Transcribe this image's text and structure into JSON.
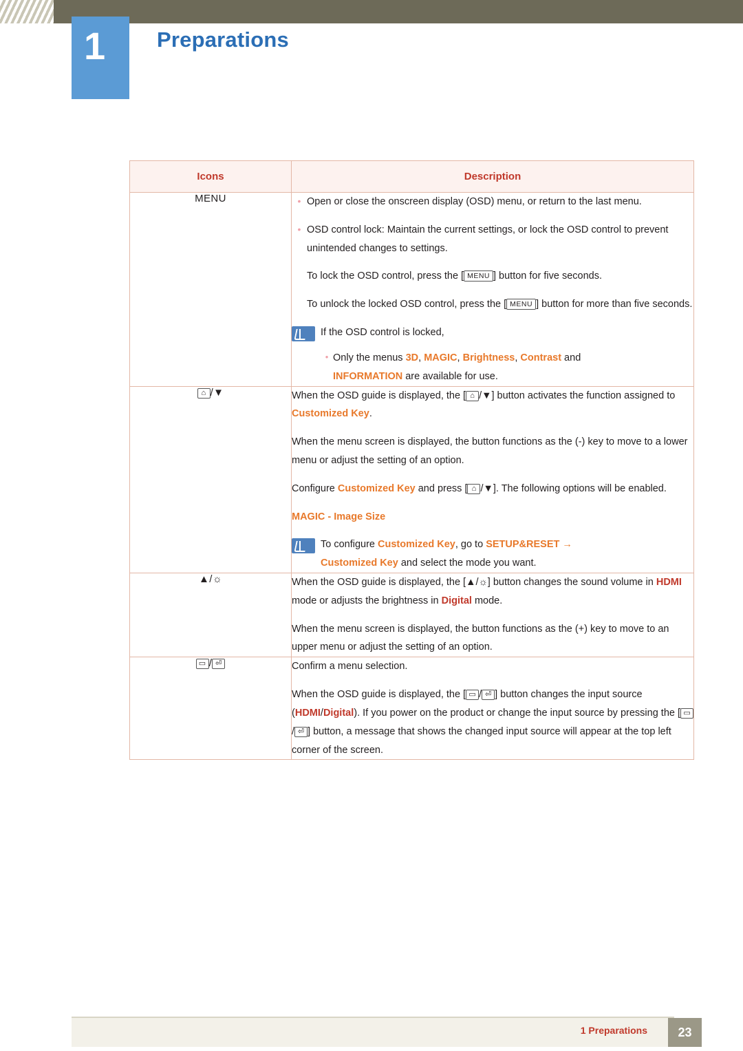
{
  "header": {
    "chapter_number": "1",
    "chapter_title": "Preparations"
  },
  "table": {
    "columns": [
      "Icons",
      "Description"
    ],
    "rows": [
      {
        "icon_label": "MENU",
        "icon_name": "menu-button-label"
      },
      {
        "icon_label": "/",
        "icon_name": "down-arrow-key-label"
      },
      {
        "icon_label": "/",
        "icon_name": "up-arrow-brightness-key-label"
      },
      {
        "icon_label": "/",
        "icon_name": "enter-source-key-label"
      }
    ],
    "row1": {
      "b1": "Open or close the onscreen display (OSD) menu, or return to the last menu.",
      "b2": "OSD control lock: Maintain the current settings, or lock the OSD control to prevent unintended changes to settings.",
      "p_lock_a": "To lock the OSD control, press the [",
      "key_menu": "MENU",
      "p_lock_b": "] button for five seconds.",
      "p_unlock_a": "To unlock the locked OSD control, press the [",
      "p_unlock_b": "] button for more than five seconds.",
      "note_head": "If the OSD control is locked,",
      "note_line_a": "Only the menus ",
      "note_3d": "3D",
      "note_sep1": ", ",
      "note_magic": "MAGIC",
      "note_sep2": ", ",
      "note_brightness": "Brightness",
      "note_sep3": ", ",
      "note_contrast": "Contrast",
      "note_and": " and",
      "note_information": "INFORMATION",
      "note_tail": " are available for use."
    },
    "row2": {
      "p1_a": "When the OSD guide is displayed, the [",
      "p1_b": "] button activates the function assigned to ",
      "p1_key": "Customized Key",
      "p1_c": ".",
      "p2": "When the menu screen is displayed, the button functions as the (-) key to move to a lower menu or adjust the setting of an option.",
      "p3_a": "Configure ",
      "p3_key": "Customized Key",
      "p3_b": " and press [",
      "p3_c": "]. The following options will be enabled.",
      "p4_magic": "MAGIC",
      "p4_rest": " - Image Size",
      "note_a": "To configure ",
      "note_key": "Customized Key",
      "note_b": ", go to ",
      "note_setup": "SETUP&RESET",
      "note_arrow": "→",
      "note_key2": "Customized Key",
      "note_c": " and select the mode you want."
    },
    "row3": {
      "p1_a": "When the OSD guide is displayed, the [",
      "p1_b": "] button changes the sound volume in ",
      "p1_hdmi": "HDMI",
      "p1_c": " mode or adjusts the brightness in ",
      "p1_digital": "Digital",
      "p1_d": " mode.",
      "p2": "When the menu screen is displayed, the button functions as the (+) key to move to an upper menu or adjust the setting of an option."
    },
    "row4": {
      "p1": "Confirm a menu selection.",
      "p2_a": "When the OSD guide is displayed, the [",
      "p2_b": "] button changes the input source (",
      "p2_hdmi": "HDMI",
      "p2_slash": "/",
      "p2_digital": "Digital",
      "p2_c": "). If you power on the product or change the input source by pressing the [",
      "p2_d": "] button, a message that shows the changed input source will appear at the top left corner of the screen."
    }
  },
  "footer": {
    "label": "1 Preparations",
    "page": "23"
  }
}
